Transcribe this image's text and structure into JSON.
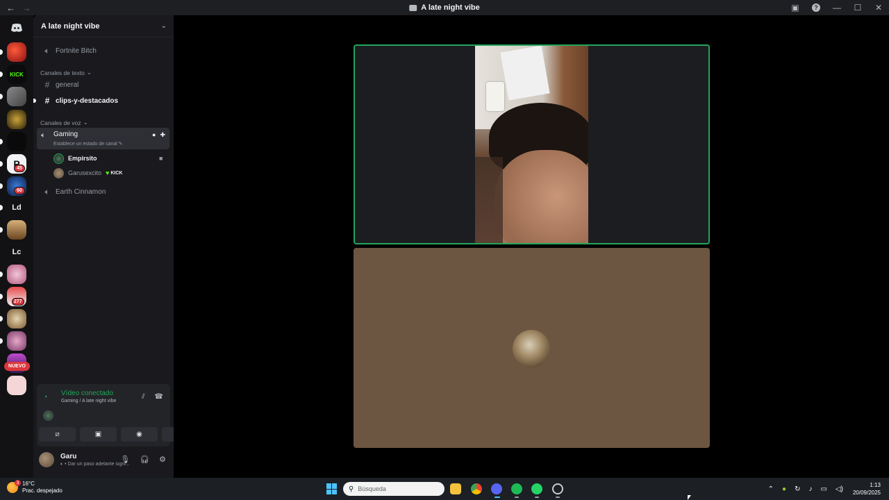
{
  "window": {
    "title": "A late night vibe",
    "back_glyph": "←",
    "forward_glyph": "→",
    "help_glyph": "?",
    "min_glyph": "—",
    "max_glyph": "☐",
    "close_glyph": "✕"
  },
  "rail": {
    "home_icon": "discord-logo-icon",
    "servers": [
      {
        "badge": ""
      },
      {
        "badge": ""
      },
      {
        "badge": ""
      },
      {
        "badge": ""
      },
      {
        "badge": ""
      },
      {
        "badge": "45"
      },
      {
        "badge": "60"
      },
      {
        "label": "Ld"
      },
      {
        "badge": ""
      },
      {
        "label": "Lc"
      },
      {
        "badge": ""
      },
      {
        "badge": "277"
      },
      {
        "badge": ""
      },
      {
        "badge": ""
      }
    ],
    "new_badge": "NUEVO"
  },
  "guild": {
    "name": "A late night vibe",
    "chevron": "⌄"
  },
  "channels": {
    "top_voice": "Fortnite Bitch",
    "text_category": "Canales de texto",
    "text_channels": [
      "general",
      "clips-y-destacados"
    ],
    "voice_category": "Canales de voz",
    "active_voice": {
      "name": "Gaming",
      "status": "Establece un estado de canal"
    },
    "members": [
      {
        "name": "Empirsito"
      },
      {
        "name": "Garusexcito",
        "tag": "KICK"
      }
    ],
    "other_voice": "Earth Cinnamon"
  },
  "voice_panel": {
    "title": "Vídeo conectado",
    "subtitle": "Gaming / A late night vibe"
  },
  "user": {
    "name": "Garu",
    "status": "Dar un paso adelante signi..."
  },
  "taskbar": {
    "weather_temp": "16°C",
    "weather_desc": "Prac. despejado",
    "weather_badge": "3",
    "search_placeholder": "Búsqueda",
    "time": "1:13",
    "date": "20/09/2025"
  },
  "colors": {
    "accent_green": "#23a55a",
    "tile_bottom": "#6d5641",
    "kick_green": "#53fc18"
  }
}
